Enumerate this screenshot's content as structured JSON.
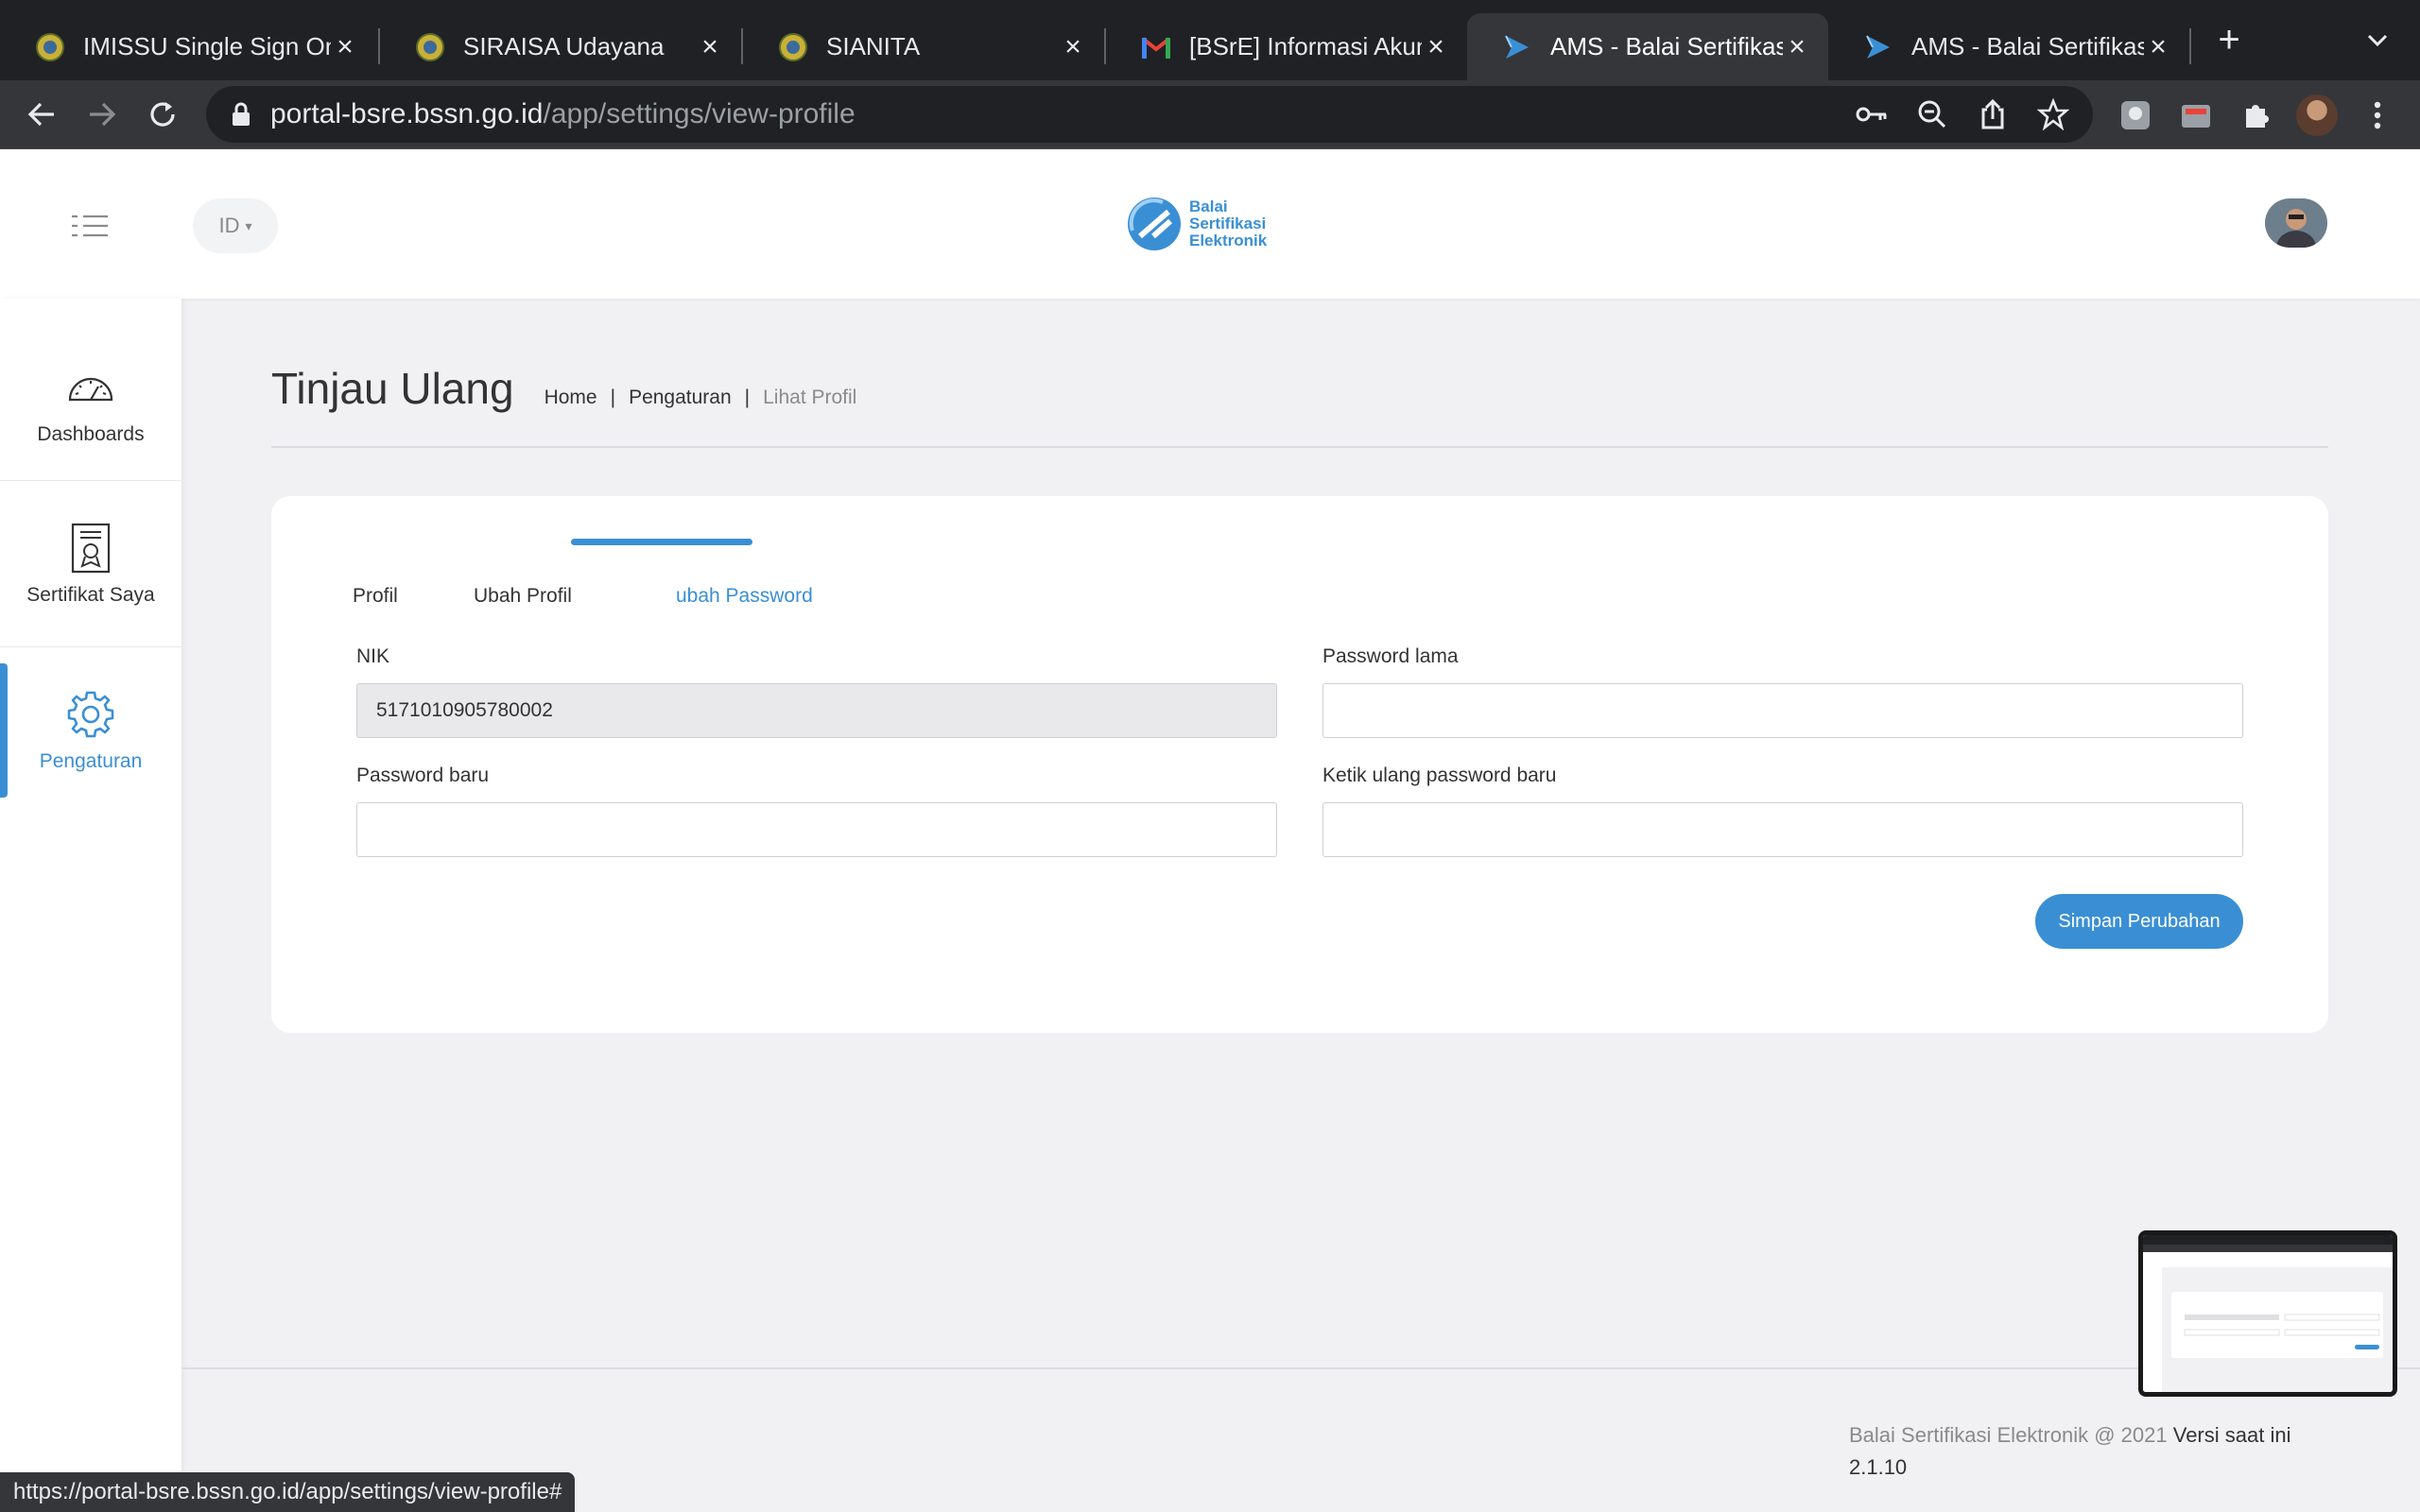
{
  "browser": {
    "tabs": [
      {
        "title": "IMISSU Single Sign On",
        "icon": "university-seal-icon"
      },
      {
        "title": "SIRAISA Udayana",
        "icon": "university-seal-icon"
      },
      {
        "title": "SIANITA",
        "icon": "university-seal-icon"
      },
      {
        "title": "[BSrE] Informasi Akun",
        "icon": "gmail-icon"
      },
      {
        "title": "AMS - Balai Sertifikasi",
        "icon": "bsre-logo-icon"
      },
      {
        "title": "AMS - Balai Sertifikasi",
        "icon": "bsre-logo-icon"
      }
    ],
    "active_tab_index": 4,
    "url_host": "portal-bsre.bssn.go.id",
    "url_path": "/app/settings/view-profile",
    "status_url": "https://portal-bsre.bssn.go.id/app/settings/view-profile#"
  },
  "header": {
    "lang": "ID",
    "logo_lines": [
      "Balai",
      "Sertifikasi",
      "Elektronik"
    ]
  },
  "sidebar": {
    "items": [
      {
        "label": "Dashboards",
        "icon": "speedometer-icon",
        "active": false
      },
      {
        "label": "Sertifikat Saya",
        "icon": "certificate-icon",
        "active": false
      },
      {
        "label": "Pengaturan",
        "icon": "gear-icon",
        "active": true
      }
    ]
  },
  "page": {
    "title": "Tinjau Ulang",
    "breadcrumb": [
      "Home",
      "Pengaturan",
      "Lihat Profil"
    ]
  },
  "profile_tabs": [
    {
      "label": "Profil"
    },
    {
      "label": "Ubah Profil"
    },
    {
      "label": "ubah Password",
      "active": true
    }
  ],
  "form": {
    "nik_label": "NIK",
    "nik_value": "5171010905780002",
    "old_password_label": "Password lama",
    "new_password_label": "Password baru",
    "confirm_password_label": "Ketik ulang password baru",
    "submit_label": "Simpan Perubahan"
  },
  "footer": {
    "copyright": "Balai Sertifikasi Elektronik @ 2021",
    "version_label": "Versi saat ini",
    "version": "2.1.10"
  },
  "colors": {
    "accent": "#3a8fd4",
    "chrome_dark": "#202124",
    "chrome_toolbar": "#35363a"
  }
}
